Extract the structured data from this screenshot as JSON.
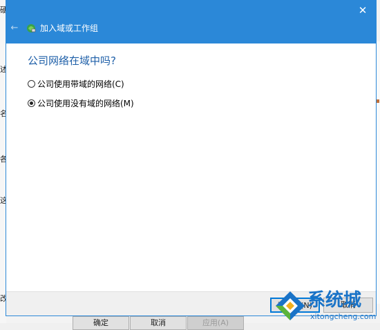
{
  "background": {
    "left_glyphs": [
      "硬",
      "述",
      "名",
      "各",
      "这",
      "改"
    ],
    "buttons": [
      "确定",
      "取消",
      "应用(A)"
    ]
  },
  "dialog": {
    "title": "加入域或工作组",
    "close_glyph": "✕",
    "back_glyph": "←",
    "question": "公司网络在域中吗?",
    "options": [
      {
        "label": "公司使用带域的网络(C)",
        "selected": false
      },
      {
        "label": "公司使用没有域的网络(M)",
        "selected": true
      }
    ],
    "footer": {
      "next_label": "下一步(N)",
      "cancel_label": "取消"
    }
  },
  "watermark": {
    "brand": "系统城",
    "url": "xitongcheng.com"
  },
  "colors": {
    "title_bar": "#2b88d8",
    "question_text": "#1e5fa8",
    "watermark": "#1a73c7"
  }
}
